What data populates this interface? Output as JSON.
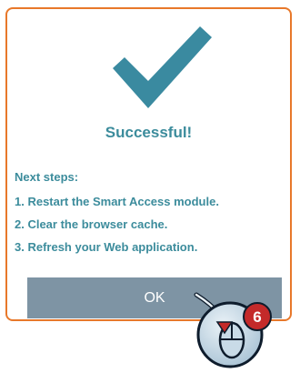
{
  "dialog": {
    "title": "Successful!",
    "steps_heading": "Next steps:",
    "steps": [
      "1. Restart the Smart Access module.",
      "2. Clear the browser cache.",
      "3. Refresh your Web application."
    ],
    "ok_label": "OK"
  },
  "annotation": {
    "step_number": "6"
  },
  "colors": {
    "accent_text": "#3c8c9c",
    "check": "#3a8aa0",
    "border": "#e8782a",
    "button": "#7e94a4",
    "badge": "#c42a2a"
  },
  "icons": [
    "checkmark-icon",
    "mouse-click-icon"
  ]
}
